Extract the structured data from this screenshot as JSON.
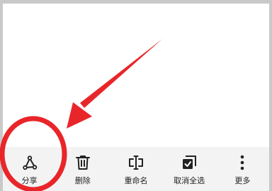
{
  "toolbar": {
    "items": [
      {
        "label": "分享",
        "icon": "share-icon"
      },
      {
        "label": "删除",
        "icon": "trash-icon"
      },
      {
        "label": "重命名",
        "icon": "rename-icon"
      },
      {
        "label": "取消全选",
        "icon": "checkbox-checked-icon"
      },
      {
        "label": "更多",
        "icon": "more-vertical-icon"
      }
    ]
  },
  "annotation": {
    "color": "#e8262a"
  }
}
